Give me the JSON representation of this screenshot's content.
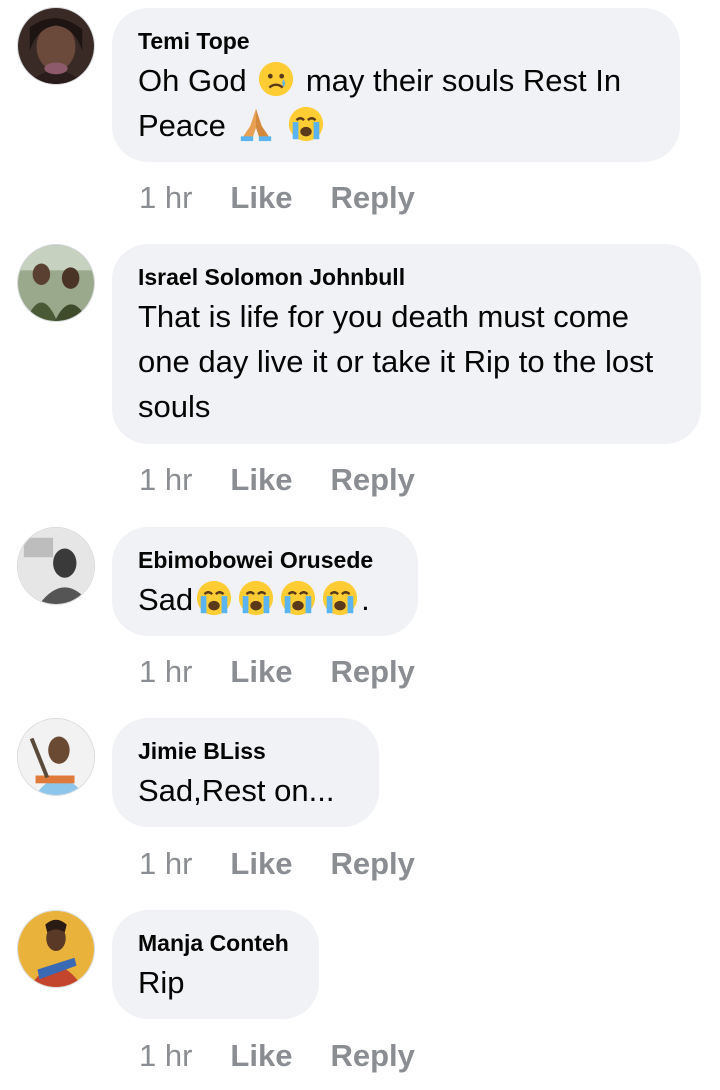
{
  "comments": [
    {
      "author": "Temi Tope",
      "text_parts": [
        "Oh God",
        "may their souls Rest In Peace",
        ""
      ],
      "time": "1 hr",
      "like_label": "Like",
      "reply_label": "Reply",
      "emojis": [
        "sad-face-emoji",
        "praying-hands-emoji",
        "crying-face-emoji"
      ]
    },
    {
      "author": "Israel Solomon Johnbull",
      "text": "That is life for you  death must come one day live it or take it  Rip to the lost souls",
      "time": "1 hr",
      "like_label": "Like",
      "reply_label": "Reply"
    },
    {
      "author": "Ebimobowei Orusede",
      "text_parts": [
        "Sad",
        "."
      ],
      "time": "1 hr",
      "like_label": "Like",
      "reply_label": "Reply",
      "emojis": [
        "crying-face-emoji",
        "crying-face-emoji",
        "crying-face-emoji",
        "crying-face-emoji"
      ]
    },
    {
      "author": "Jimie BLiss",
      "text": "Sad,Rest on...",
      "time": "1 hr",
      "like_label": "Like",
      "reply_label": "Reply"
    },
    {
      "author": "Manja Conteh",
      "text": "Rip",
      "time": "1 hr",
      "like_label": "Like",
      "reply_label": "Reply"
    }
  ],
  "colors": {
    "bubble": "#f0f2f5",
    "action_text": "#8a8d91",
    "author_text": "#050505"
  }
}
